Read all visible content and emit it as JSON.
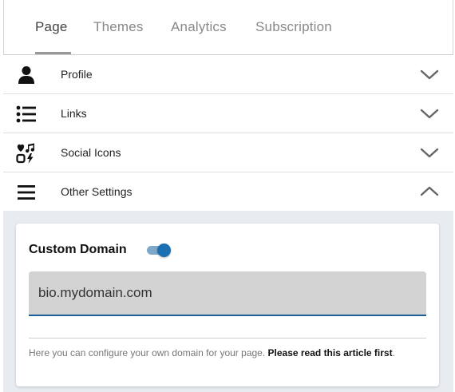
{
  "tabs": [
    {
      "label": "Page",
      "active": true
    },
    {
      "label": "Themes",
      "active": false
    },
    {
      "label": "Analytics",
      "active": false
    },
    {
      "label": "Subscription",
      "active": false
    }
  ],
  "accordion": [
    {
      "label": "Profile",
      "icon": "person-icon",
      "expanded": false
    },
    {
      "label": "Links",
      "icon": "list-icon",
      "expanded": false
    },
    {
      "label": "Social Icons",
      "icon": "social-icons-icon",
      "expanded": false
    },
    {
      "label": "Other Settings",
      "icon": "menu-icon",
      "expanded": true
    }
  ],
  "custom_domain": {
    "title": "Custom Domain",
    "enabled": true,
    "value": "bio.mydomain.com",
    "help_text": "Here you can configure your own domain for your page. ",
    "help_link": "Please read this article first",
    "help_end": "."
  },
  "colors": {
    "accent": "#1b6fb3",
    "panel_bg": "#e8ecf1",
    "input_bg": "#d3d3d3"
  }
}
